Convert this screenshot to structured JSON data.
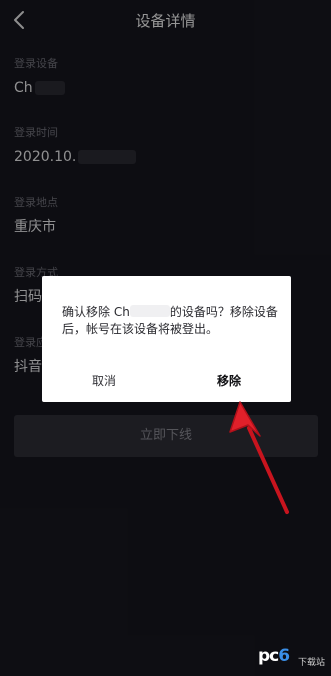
{
  "header": {
    "title": "设备详情"
  },
  "fields": [
    {
      "label": "登录设备",
      "value": "Ch"
    },
    {
      "label": "登录时间",
      "value": "2020.10."
    },
    {
      "label": "登录地点",
      "value": "重庆市"
    },
    {
      "label": "登录方式",
      "value": "扫码"
    },
    {
      "label": "登录应用",
      "value": "抖音"
    }
  ],
  "logout_button": "立即下线",
  "dialog": {
    "message_part1": "确认移除 Ch",
    "message_part2": "的设备吗？移除设备后，帐号在该设备将被登出。",
    "cancel_label": "取消",
    "remove_label": "移除"
  },
  "watermark": {
    "logo_prefix": "pc",
    "logo_digit": "6",
    "sub": "下载站"
  },
  "colors": {
    "background": "#16161e",
    "dialog": "#ffffff",
    "arrow": "#e0202a",
    "button": "#2e2e36"
  }
}
